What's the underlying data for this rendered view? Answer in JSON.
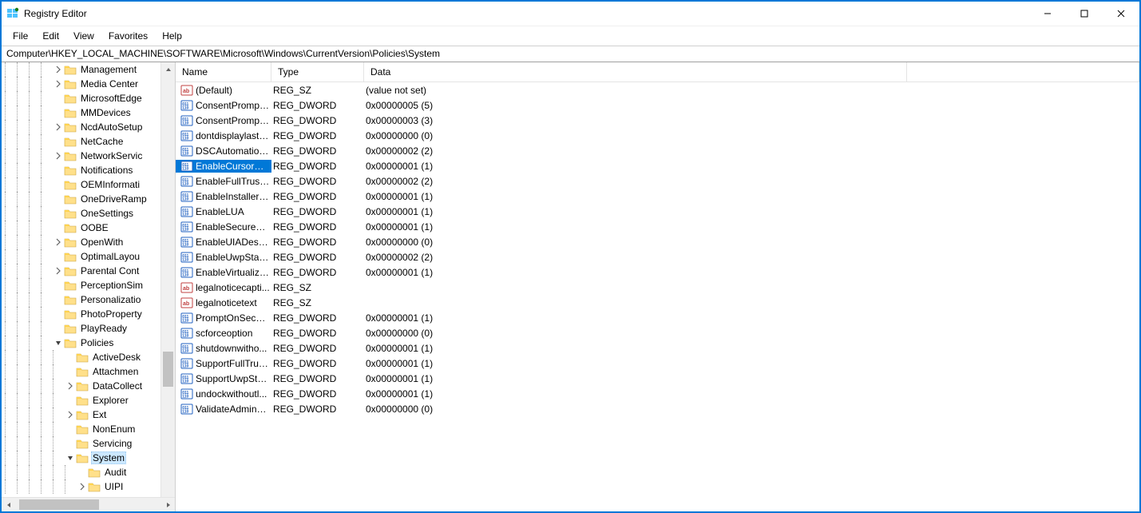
{
  "window_title": "Registry Editor",
  "menus": [
    "File",
    "Edit",
    "View",
    "Favorites",
    "Help"
  ],
  "address": "Computer\\HKEY_LOCAL_MACHINE\\SOFTWARE\\Microsoft\\Windows\\CurrentVersion\\Policies\\System",
  "columns": {
    "name": "Name",
    "type": "Type",
    "data": "Data"
  },
  "tree": [
    {
      "depth": 4,
      "expander": "right",
      "label": "Management"
    },
    {
      "depth": 4,
      "expander": "right",
      "label": "Media Center"
    },
    {
      "depth": 4,
      "expander": "none",
      "label": "MicrosoftEdge"
    },
    {
      "depth": 4,
      "expander": "none",
      "label": "MMDevices"
    },
    {
      "depth": 4,
      "expander": "right",
      "label": "NcdAutoSetup"
    },
    {
      "depth": 4,
      "expander": "none",
      "label": "NetCache"
    },
    {
      "depth": 4,
      "expander": "right",
      "label": "NetworkServic"
    },
    {
      "depth": 4,
      "expander": "none",
      "label": "Notifications"
    },
    {
      "depth": 4,
      "expander": "none",
      "label": "OEMInformati"
    },
    {
      "depth": 4,
      "expander": "none",
      "label": "OneDriveRamp"
    },
    {
      "depth": 4,
      "expander": "none",
      "label": "OneSettings"
    },
    {
      "depth": 4,
      "expander": "none",
      "label": "OOBE"
    },
    {
      "depth": 4,
      "expander": "right",
      "label": "OpenWith"
    },
    {
      "depth": 4,
      "expander": "none",
      "label": "OptimalLayou"
    },
    {
      "depth": 4,
      "expander": "right",
      "label": "Parental Cont"
    },
    {
      "depth": 4,
      "expander": "none",
      "label": "PerceptionSim"
    },
    {
      "depth": 4,
      "expander": "none",
      "label": "Personalizatio"
    },
    {
      "depth": 4,
      "expander": "none",
      "label": "PhotoProperty"
    },
    {
      "depth": 4,
      "expander": "none",
      "label": "PlayReady"
    },
    {
      "depth": 4,
      "expander": "down",
      "label": "Policies"
    },
    {
      "depth": 5,
      "expander": "none",
      "label": "ActiveDesk"
    },
    {
      "depth": 5,
      "expander": "none",
      "label": "Attachmen"
    },
    {
      "depth": 5,
      "expander": "right",
      "label": "DataCollect"
    },
    {
      "depth": 5,
      "expander": "none",
      "label": "Explorer"
    },
    {
      "depth": 5,
      "expander": "right",
      "label": "Ext"
    },
    {
      "depth": 5,
      "expander": "none",
      "label": "NonEnum"
    },
    {
      "depth": 5,
      "expander": "none",
      "label": "Servicing"
    },
    {
      "depth": 5,
      "expander": "down",
      "label": "System",
      "selected": true
    },
    {
      "depth": 6,
      "expander": "none",
      "label": "Audit"
    },
    {
      "depth": 6,
      "expander": "right",
      "label": "UIPI"
    }
  ],
  "values": [
    {
      "icon": "sz",
      "name": "(Default)",
      "type": "REG_SZ",
      "data": "(value not set)"
    },
    {
      "icon": "dw",
      "name": "ConsentPrompt...",
      "type": "REG_DWORD",
      "data": "0x00000005 (5)"
    },
    {
      "icon": "dw",
      "name": "ConsentPrompt...",
      "type": "REG_DWORD",
      "data": "0x00000003 (3)"
    },
    {
      "icon": "dw",
      "name": "dontdisplaylastu...",
      "type": "REG_DWORD",
      "data": "0x00000000 (0)"
    },
    {
      "icon": "dw",
      "name": "DSCAutomation...",
      "type": "REG_DWORD",
      "data": "0x00000002 (2)"
    },
    {
      "icon": "dw",
      "name": "EnableCursorSu...",
      "type": "REG_DWORD",
      "data": "0x00000001 (1)",
      "selected": true
    },
    {
      "icon": "dw",
      "name": "EnableFullTrustS...",
      "type": "REG_DWORD",
      "data": "0x00000002 (2)"
    },
    {
      "icon": "dw",
      "name": "EnableInstallerD...",
      "type": "REG_DWORD",
      "data": "0x00000001 (1)"
    },
    {
      "icon": "dw",
      "name": "EnableLUA",
      "type": "REG_DWORD",
      "data": "0x00000001 (1)"
    },
    {
      "icon": "dw",
      "name": "EnableSecureUI...",
      "type": "REG_DWORD",
      "data": "0x00000001 (1)"
    },
    {
      "icon": "dw",
      "name": "EnableUIADeskt...",
      "type": "REG_DWORD",
      "data": "0x00000000 (0)"
    },
    {
      "icon": "dw",
      "name": "EnableUwpStart...",
      "type": "REG_DWORD",
      "data": "0x00000002 (2)"
    },
    {
      "icon": "dw",
      "name": "EnableVirtualizat...",
      "type": "REG_DWORD",
      "data": "0x00000001 (1)"
    },
    {
      "icon": "sz",
      "name": "legalnoticecapti...",
      "type": "REG_SZ",
      "data": ""
    },
    {
      "icon": "sz",
      "name": "legalnoticetext",
      "type": "REG_SZ",
      "data": ""
    },
    {
      "icon": "dw",
      "name": "PromptOnSecur...",
      "type": "REG_DWORD",
      "data": "0x00000001 (1)"
    },
    {
      "icon": "dw",
      "name": "scforceoption",
      "type": "REG_DWORD",
      "data": "0x00000000 (0)"
    },
    {
      "icon": "dw",
      "name": "shutdownwitho...",
      "type": "REG_DWORD",
      "data": "0x00000001 (1)"
    },
    {
      "icon": "dw",
      "name": "SupportFullTrust...",
      "type": "REG_DWORD",
      "data": "0x00000001 (1)"
    },
    {
      "icon": "dw",
      "name": "SupportUwpStar...",
      "type": "REG_DWORD",
      "data": "0x00000001 (1)"
    },
    {
      "icon": "dw",
      "name": "undockwithoutl...",
      "type": "REG_DWORD",
      "data": "0x00000001 (1)"
    },
    {
      "icon": "dw",
      "name": "ValidateAdminC...",
      "type": "REG_DWORD",
      "data": "0x00000000 (0)"
    }
  ]
}
